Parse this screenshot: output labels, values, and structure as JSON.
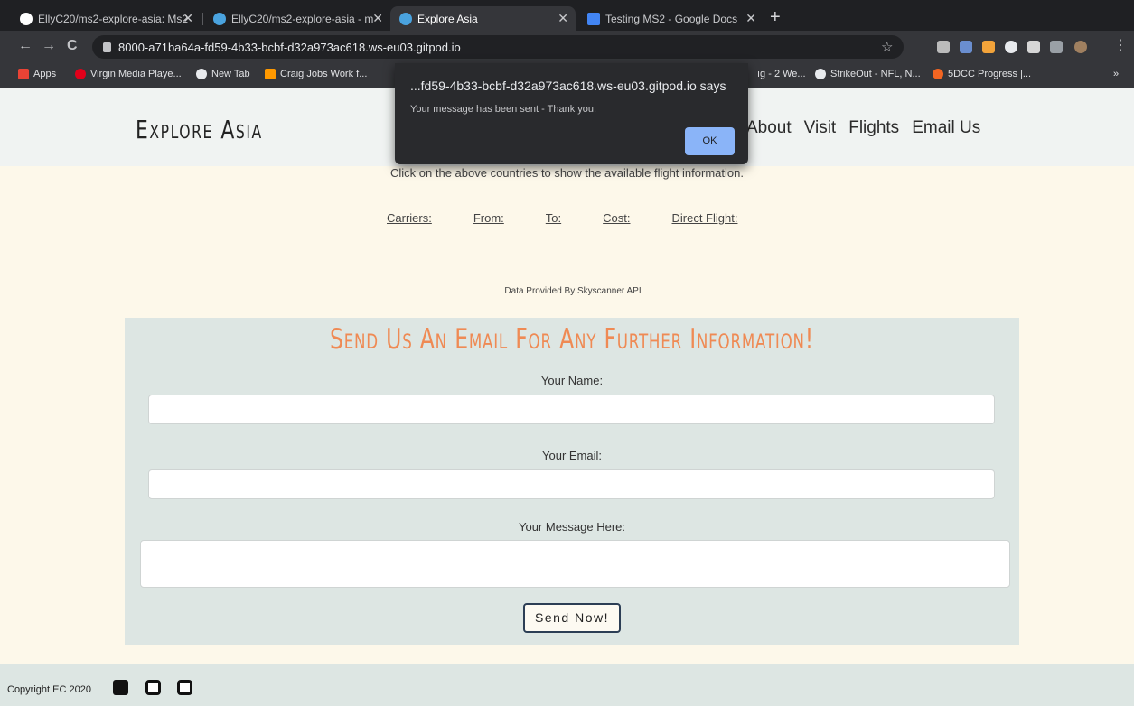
{
  "browser": {
    "tabs": [
      {
        "title": "EllyC20/ms2-explore-asia: Ms2",
        "favicon_color": "#ffffff"
      },
      {
        "title": "EllyC20/ms2-explore-asia - m",
        "favicon_color": "#4aa3df"
      },
      {
        "title": "Explore Asia",
        "favicon_color": "#4aa3df"
      },
      {
        "title": "Testing MS2 - Google Docs",
        "favicon_color": "#4285f4"
      }
    ],
    "new_tab": "+",
    "url": "8000-a71ba64a-fd59-4b33-bcbf-d32a973ac618.ws-eu03.gitpod.io",
    "bookmarks": [
      {
        "label": "Apps",
        "color": "#ea4335"
      },
      {
        "label": "Virgin Media Playe...",
        "color": "#e2001a"
      },
      {
        "label": "New Tab",
        "color": "#e8eaed"
      },
      {
        "label": "Craig Jobs Work f...",
        "color": "#ff9900"
      },
      {
        "label": "ıg - 2 We...",
        "color": "#35363a"
      },
      {
        "label": "StrikeOut - NFL, N...",
        "color": "#e8eaed"
      },
      {
        "label": "5DCC Progress |...",
        "color": "#f26522"
      }
    ],
    "bookmarks_more": "»"
  },
  "site": {
    "brand": "Explore Asia",
    "nav": [
      "About",
      "Visit",
      "Flights",
      "Email Us"
    ],
    "intro": "Click on the above countries to show the available flight information.",
    "flight_labels": [
      "Carriers:",
      "From:",
      "To:",
      "Cost:",
      "Direct Flight:"
    ],
    "provided": "Data Provided By Skyscanner API"
  },
  "contact": {
    "title": "Send Us An Email For Any Further Information!",
    "name_label": "Your Name:",
    "email_label": "Your Email:",
    "message_label": "Your Message Here:",
    "name_value": "",
    "email_value": "",
    "message_value": "",
    "send_label": "Send Now!"
  },
  "footer": {
    "copyright": "Copyright EC 2020",
    "icons": [
      "facebook-icon",
      "instagram-icon",
      "youtube-icon"
    ]
  },
  "alert": {
    "title": "...fd59-4b33-bcbf-d32a973ac618.ws-eu03.gitpod.io says",
    "message": "Your message has been sent - Thank you.",
    "ok_label": "OK"
  },
  "colors": {
    "accent": "#ef8a54",
    "page_bg": "#fdf8ea",
    "section_bg": "#dde6e3",
    "dialog_button": "#8ab4f8"
  }
}
